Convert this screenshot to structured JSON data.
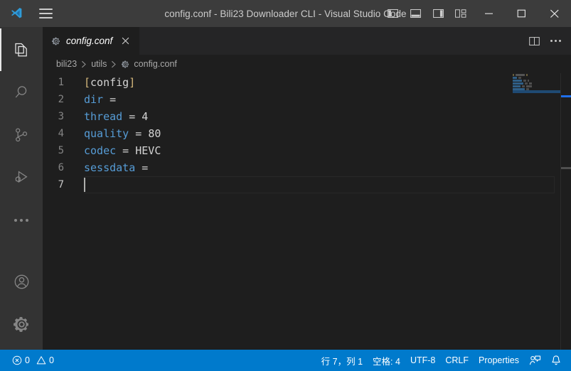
{
  "window": {
    "title": "config.conf - Bili23 Downloader CLI - Visual Studio Code",
    "logo_icon": "vscode-logo-icon",
    "menu_icon": "hamburger-menu-icon",
    "layout_buttons": [
      {
        "icon": "toggle-primary-sidebar-icon",
        "label": "Toggle Primary Side Bar"
      },
      {
        "icon": "toggle-panel-icon",
        "label": "Toggle Panel"
      },
      {
        "icon": "toggle-secondary-sidebar-icon",
        "label": "Toggle Secondary Side Bar"
      },
      {
        "icon": "customize-layout-icon",
        "label": "Customize Layout"
      }
    ],
    "controls": [
      {
        "icon": "minimize-icon",
        "label": "Minimize"
      },
      {
        "icon": "maximize-icon",
        "label": "Maximize"
      },
      {
        "icon": "close-icon",
        "label": "Close"
      }
    ]
  },
  "activity_bar": {
    "items": [
      {
        "icon": "files-explorer-icon",
        "label": "Explorer",
        "active": true
      },
      {
        "icon": "search-icon",
        "label": "Search",
        "active": false
      },
      {
        "icon": "source-control-icon",
        "label": "Source Control",
        "active": false
      },
      {
        "icon": "run-and-debug-icon",
        "label": "Run and Debug",
        "active": false
      },
      {
        "icon": "more-views-icon",
        "label": "Additional Views",
        "active": false
      }
    ],
    "bottom_items": [
      {
        "icon": "account-icon",
        "label": "Accounts"
      },
      {
        "icon": "settings-gear-icon",
        "label": "Manage"
      }
    ]
  },
  "tabs": {
    "open": [
      {
        "icon": "properties-file-icon",
        "label": "config.conf",
        "active": true,
        "preview": true,
        "close_icon": "close-icon"
      }
    ],
    "actions": [
      {
        "icon": "split-editor-icon",
        "label": "Split Editor Right"
      },
      {
        "icon": "more-actions-icon",
        "label": "More Actions..."
      }
    ]
  },
  "breadcrumb": {
    "segments": [
      "bili23",
      "utils",
      "config.conf"
    ],
    "separator": "›",
    "file_icon": "properties-file-icon"
  },
  "editor": {
    "language_icon": "properties-file-icon",
    "lines": [
      {
        "number": "1",
        "tokens": [
          {
            "text": "[",
            "type": "brk"
          },
          {
            "text": "config",
            "type": "sec"
          },
          {
            "text": "]",
            "type": "brk"
          }
        ]
      },
      {
        "number": "2",
        "tokens": [
          {
            "text": "dir",
            "type": "key"
          },
          {
            "text": " = ",
            "type": "op"
          }
        ]
      },
      {
        "number": "3",
        "tokens": [
          {
            "text": "thread",
            "type": "key"
          },
          {
            "text": " = ",
            "type": "op"
          },
          {
            "text": "4",
            "type": "val"
          }
        ]
      },
      {
        "number": "4",
        "tokens": [
          {
            "text": "quality",
            "type": "key"
          },
          {
            "text": " = ",
            "type": "op"
          },
          {
            "text": "80",
            "type": "val"
          }
        ]
      },
      {
        "number": "5",
        "tokens": [
          {
            "text": "codec",
            "type": "key"
          },
          {
            "text": " = ",
            "type": "op"
          },
          {
            "text": "HEVC",
            "type": "val"
          }
        ]
      },
      {
        "number": "6",
        "tokens": [
          {
            "text": "sessdata",
            "type": "key"
          },
          {
            "text": " = ",
            "type": "op"
          }
        ]
      },
      {
        "number": "7",
        "tokens": [],
        "active": true,
        "cursor": true
      }
    ]
  },
  "status_bar": {
    "left": [
      {
        "name": "problems",
        "error_icon": "error-circle-icon",
        "error_count": "0",
        "warning_icon": "warning-triangle-icon",
        "warning_count": "0"
      }
    ],
    "right": [
      {
        "name": "cursor-position",
        "label": "行 7，列 1"
      },
      {
        "name": "indentation",
        "label": "空格: 4"
      },
      {
        "name": "encoding",
        "label": "UTF-8"
      },
      {
        "name": "eol",
        "label": "CRLF"
      },
      {
        "name": "language-mode",
        "label": "Properties"
      }
    ],
    "icons": [
      {
        "name": "feedback-icon",
        "label": "Tweet Feedback"
      },
      {
        "name": "notifications-bell-icon",
        "label": "No Notifications"
      }
    ]
  },
  "colors": {
    "titlebar_bg": "#3c3c3c",
    "activitybar_bg": "#333333",
    "editor_bg": "#1e1e1e",
    "tabbar_bg": "#252526",
    "statusbar_bg": "#007acc",
    "accent": "#007acc",
    "keyword": "#569cd6",
    "bracket": "#d7ba7d",
    "text": "#d4d4d4"
  }
}
